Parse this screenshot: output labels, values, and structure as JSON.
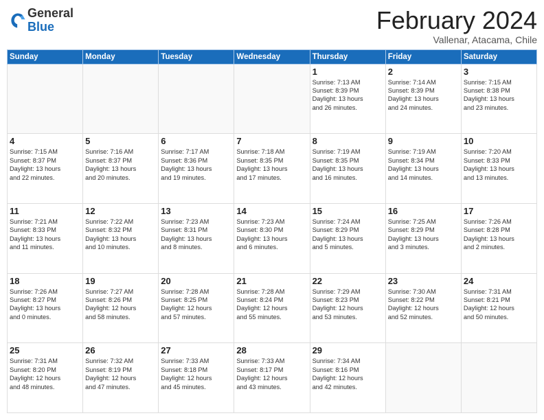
{
  "logo": {
    "general": "General",
    "blue": "Blue"
  },
  "header": {
    "month": "February 2024",
    "location": "Vallenar, Atacama, Chile"
  },
  "days_of_week": [
    "Sunday",
    "Monday",
    "Tuesday",
    "Wednesday",
    "Thursday",
    "Friday",
    "Saturday"
  ],
  "weeks": [
    [
      {
        "day": "",
        "info": ""
      },
      {
        "day": "",
        "info": ""
      },
      {
        "day": "",
        "info": ""
      },
      {
        "day": "",
        "info": ""
      },
      {
        "day": "1",
        "info": "Sunrise: 7:13 AM\nSunset: 8:39 PM\nDaylight: 13 hours\nand 26 minutes."
      },
      {
        "day": "2",
        "info": "Sunrise: 7:14 AM\nSunset: 8:39 PM\nDaylight: 13 hours\nand 24 minutes."
      },
      {
        "day": "3",
        "info": "Sunrise: 7:15 AM\nSunset: 8:38 PM\nDaylight: 13 hours\nand 23 minutes."
      }
    ],
    [
      {
        "day": "4",
        "info": "Sunrise: 7:15 AM\nSunset: 8:37 PM\nDaylight: 13 hours\nand 22 minutes."
      },
      {
        "day": "5",
        "info": "Sunrise: 7:16 AM\nSunset: 8:37 PM\nDaylight: 13 hours\nand 20 minutes."
      },
      {
        "day": "6",
        "info": "Sunrise: 7:17 AM\nSunset: 8:36 PM\nDaylight: 13 hours\nand 19 minutes."
      },
      {
        "day": "7",
        "info": "Sunrise: 7:18 AM\nSunset: 8:35 PM\nDaylight: 13 hours\nand 17 minutes."
      },
      {
        "day": "8",
        "info": "Sunrise: 7:19 AM\nSunset: 8:35 PM\nDaylight: 13 hours\nand 16 minutes."
      },
      {
        "day": "9",
        "info": "Sunrise: 7:19 AM\nSunset: 8:34 PM\nDaylight: 13 hours\nand 14 minutes."
      },
      {
        "day": "10",
        "info": "Sunrise: 7:20 AM\nSunset: 8:33 PM\nDaylight: 13 hours\nand 13 minutes."
      }
    ],
    [
      {
        "day": "11",
        "info": "Sunrise: 7:21 AM\nSunset: 8:33 PM\nDaylight: 13 hours\nand 11 minutes."
      },
      {
        "day": "12",
        "info": "Sunrise: 7:22 AM\nSunset: 8:32 PM\nDaylight: 13 hours\nand 10 minutes."
      },
      {
        "day": "13",
        "info": "Sunrise: 7:23 AM\nSunset: 8:31 PM\nDaylight: 13 hours\nand 8 minutes."
      },
      {
        "day": "14",
        "info": "Sunrise: 7:23 AM\nSunset: 8:30 PM\nDaylight: 13 hours\nand 6 minutes."
      },
      {
        "day": "15",
        "info": "Sunrise: 7:24 AM\nSunset: 8:29 PM\nDaylight: 13 hours\nand 5 minutes."
      },
      {
        "day": "16",
        "info": "Sunrise: 7:25 AM\nSunset: 8:29 PM\nDaylight: 13 hours\nand 3 minutes."
      },
      {
        "day": "17",
        "info": "Sunrise: 7:26 AM\nSunset: 8:28 PM\nDaylight: 13 hours\nand 2 minutes."
      }
    ],
    [
      {
        "day": "18",
        "info": "Sunrise: 7:26 AM\nSunset: 8:27 PM\nDaylight: 13 hours\nand 0 minutes."
      },
      {
        "day": "19",
        "info": "Sunrise: 7:27 AM\nSunset: 8:26 PM\nDaylight: 12 hours\nand 58 minutes."
      },
      {
        "day": "20",
        "info": "Sunrise: 7:28 AM\nSunset: 8:25 PM\nDaylight: 12 hours\nand 57 minutes."
      },
      {
        "day": "21",
        "info": "Sunrise: 7:28 AM\nSunset: 8:24 PM\nDaylight: 12 hours\nand 55 minutes."
      },
      {
        "day": "22",
        "info": "Sunrise: 7:29 AM\nSunset: 8:23 PM\nDaylight: 12 hours\nand 53 minutes."
      },
      {
        "day": "23",
        "info": "Sunrise: 7:30 AM\nSunset: 8:22 PM\nDaylight: 12 hours\nand 52 minutes."
      },
      {
        "day": "24",
        "info": "Sunrise: 7:31 AM\nSunset: 8:21 PM\nDaylight: 12 hours\nand 50 minutes."
      }
    ],
    [
      {
        "day": "25",
        "info": "Sunrise: 7:31 AM\nSunset: 8:20 PM\nDaylight: 12 hours\nand 48 minutes."
      },
      {
        "day": "26",
        "info": "Sunrise: 7:32 AM\nSunset: 8:19 PM\nDaylight: 12 hours\nand 47 minutes."
      },
      {
        "day": "27",
        "info": "Sunrise: 7:33 AM\nSunset: 8:18 PM\nDaylight: 12 hours\nand 45 minutes."
      },
      {
        "day": "28",
        "info": "Sunrise: 7:33 AM\nSunset: 8:17 PM\nDaylight: 12 hours\nand 43 minutes."
      },
      {
        "day": "29",
        "info": "Sunrise: 7:34 AM\nSunset: 8:16 PM\nDaylight: 12 hours\nand 42 minutes."
      },
      {
        "day": "",
        "info": ""
      },
      {
        "day": "",
        "info": ""
      }
    ]
  ]
}
